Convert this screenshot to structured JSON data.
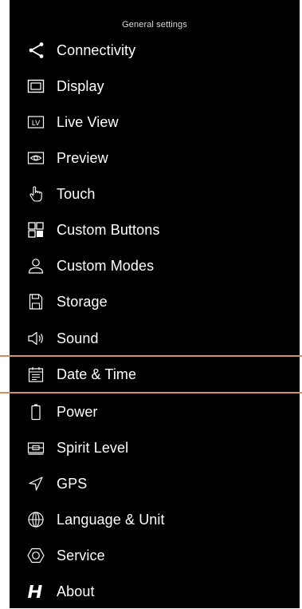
{
  "header": {
    "title": "General settings"
  },
  "menu": [
    {
      "key": "connectivity",
      "label": "Connectivity",
      "icon": "share-icon"
    },
    {
      "key": "display",
      "label": "Display",
      "icon": "display-icon"
    },
    {
      "key": "live_view",
      "label": "Live View",
      "icon": "live-view-icon"
    },
    {
      "key": "preview",
      "label": "Preview",
      "icon": "eye-icon"
    },
    {
      "key": "touch",
      "label": "Touch",
      "icon": "touch-hand-icon"
    },
    {
      "key": "custom_buttons",
      "label": "Custom Buttons",
      "icon": "custom-buttons-grid-icon"
    },
    {
      "key": "custom_modes",
      "label": "Custom Modes",
      "icon": "person-icon"
    },
    {
      "key": "storage",
      "label": "Storage",
      "icon": "storage-card-icon"
    },
    {
      "key": "sound",
      "label": "Sound",
      "icon": "speaker-icon"
    },
    {
      "key": "date_time",
      "label": "Date & Time",
      "icon": "calendar-icon",
      "selected": true
    },
    {
      "key": "power",
      "label": "Power",
      "icon": "battery-icon"
    },
    {
      "key": "spirit_level",
      "label": "Spirit Level",
      "icon": "spirit-level-icon"
    },
    {
      "key": "gps",
      "label": "GPS",
      "icon": "location-arrow-icon"
    },
    {
      "key": "language_unit",
      "label": "Language & Unit",
      "icon": "globe-icon"
    },
    {
      "key": "service",
      "label": "Service",
      "icon": "service-hexagon-icon"
    },
    {
      "key": "about",
      "label": "About",
      "icon": "hasselblad-logo-icon"
    }
  ],
  "colors": {
    "background": "#000000",
    "text": "#ffffff",
    "selection_accent": "#d98b61",
    "outer": "#ffffff"
  }
}
